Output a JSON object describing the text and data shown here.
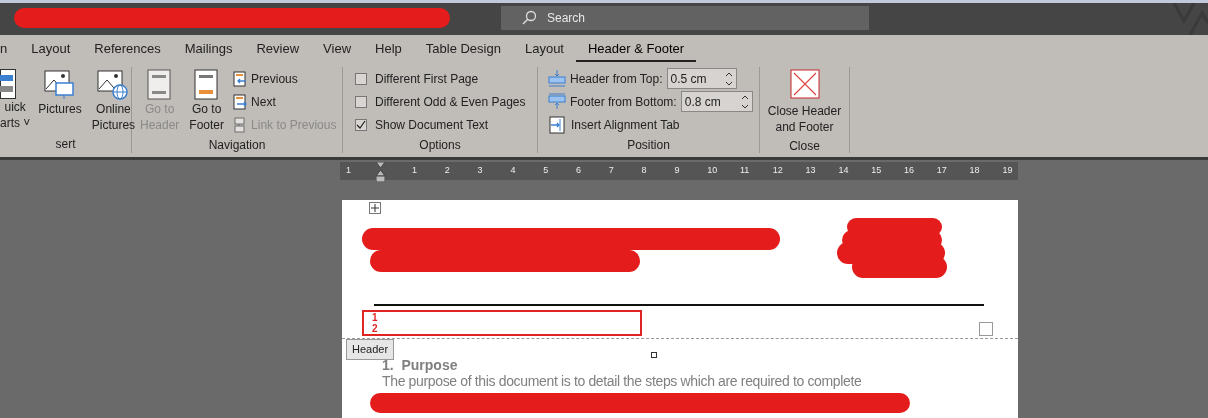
{
  "title_bar": {
    "search": {
      "placeholder": "Search"
    }
  },
  "tabs": [
    {
      "label": "n",
      "selected": false
    },
    {
      "label": "Layout",
      "selected": false
    },
    {
      "label": "References",
      "selected": false
    },
    {
      "label": "Mailings",
      "selected": false
    },
    {
      "label": "Review",
      "selected": false
    },
    {
      "label": "View",
      "selected": false
    },
    {
      "label": "Help",
      "selected": false
    },
    {
      "label": "Table Design",
      "selected": false
    },
    {
      "label": "Layout",
      "selected": false
    },
    {
      "label": "Header & Footer",
      "selected": true
    }
  ],
  "insert_group": {
    "label": "sert",
    "buttons": [
      {
        "kind": "parts",
        "lines": [
          "uick",
          "arts ˅"
        ]
      },
      {
        "kind": "pictures",
        "lines": [
          "Pictures"
        ]
      },
      {
        "kind": "online",
        "lines": [
          "Online",
          "Pictures"
        ]
      }
    ]
  },
  "navigation_group": {
    "label": "Navigation",
    "big_buttons": [
      {
        "kind": "header",
        "lines": [
          "Go to",
          "Header"
        ],
        "disabled": true
      },
      {
        "kind": "footer",
        "lines": [
          "Go to",
          "Footer"
        ],
        "disabled": false
      }
    ],
    "small_buttons": [
      {
        "kind": "previous",
        "label": "Previous",
        "disabled": false
      },
      {
        "kind": "next",
        "label": "Next",
        "disabled": false
      },
      {
        "kind": "link",
        "label": "Link to Previous",
        "disabled": true
      }
    ]
  },
  "options_group": {
    "label": "Options",
    "checkboxes": [
      {
        "label": "Different First Page",
        "checked": false
      },
      {
        "label": "Different Odd & Even Pages",
        "checked": false
      },
      {
        "label": "Show Document Text",
        "checked": true
      }
    ]
  },
  "position_group": {
    "label": "Position",
    "fields": [
      {
        "kind": "top",
        "label": "Header from Top:",
        "value": "0.5 cm"
      },
      {
        "kind": "bottom",
        "label": "Footer from Bottom:",
        "value": "0.8 cm"
      }
    ],
    "button": "Insert Alignment Tab"
  },
  "close_group": {
    "label": "Close",
    "button": [
      "Close Header",
      "and Footer"
    ]
  },
  "ruler": {
    "labels": [
      "1",
      "1",
      "2",
      "3",
      "4",
      "5",
      "6",
      "7",
      "8",
      "9",
      "10",
      "11",
      "12",
      "13",
      "14",
      "15",
      "16",
      "17",
      "18",
      "19"
    ]
  },
  "document": {
    "header_lines": [
      "1",
      "2"
    ],
    "header_tag": "Header",
    "heading": "1.  Purpose",
    "paragraph": "The purpose of this document is to detail the steps which are required to complete"
  }
}
